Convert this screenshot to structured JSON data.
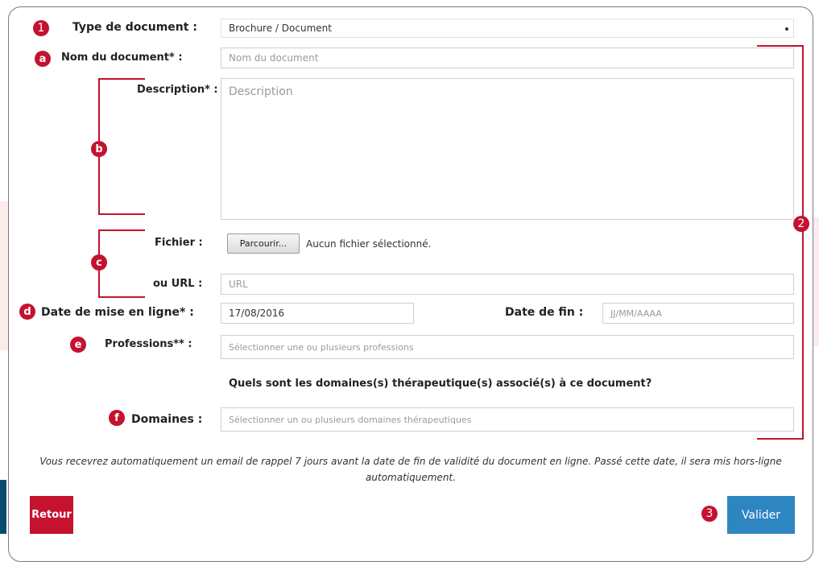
{
  "form": {
    "type_label": "Type de document :",
    "type_value": "Brochure / Document",
    "name_label": "Nom du document* :",
    "name_placeholder": "Nom du document",
    "description_label": "Description* :",
    "description_placeholder": "Description",
    "file_label": "Fichier :",
    "browse_label": "Parcourir...",
    "no_file_text": "Aucun fichier sélectionné.",
    "url_label": "ou URL :",
    "url_placeholder": "URL",
    "date_online_label": "Date de mise en ligne* :",
    "date_online_value": "17/08/2016",
    "date_end_label": "Date de fin :",
    "date_end_placeholder": "JJ/MM/AAAA",
    "professions_label": "Professions** :",
    "professions_placeholder": "Sélectionner une ou plusieurs professions",
    "question": "Quels sont les domaines(s) thérapeutique(s) associé(s) à ce document?",
    "domains_label": "Domaines :",
    "domains_placeholder": "Sélectionner un ou plusieurs domaines thérapeutiques",
    "note": "Vous recevrez automatiquement un email de rappel 7 jours avant la date de fin de validité du document en ligne. Passé cette date, il sera mis hors-ligne automatiquement."
  },
  "buttons": {
    "back": "Retour",
    "submit": "Valider"
  },
  "annotations": {
    "n1": "1",
    "n2": "2",
    "n3": "3",
    "a": "a",
    "b": "b",
    "c": "c",
    "d": "d",
    "e": "e",
    "f": "f"
  },
  "colors": {
    "accent_red": "#c4122f",
    "button_red": "#c4122f",
    "button_blue": "#2e86c1"
  }
}
